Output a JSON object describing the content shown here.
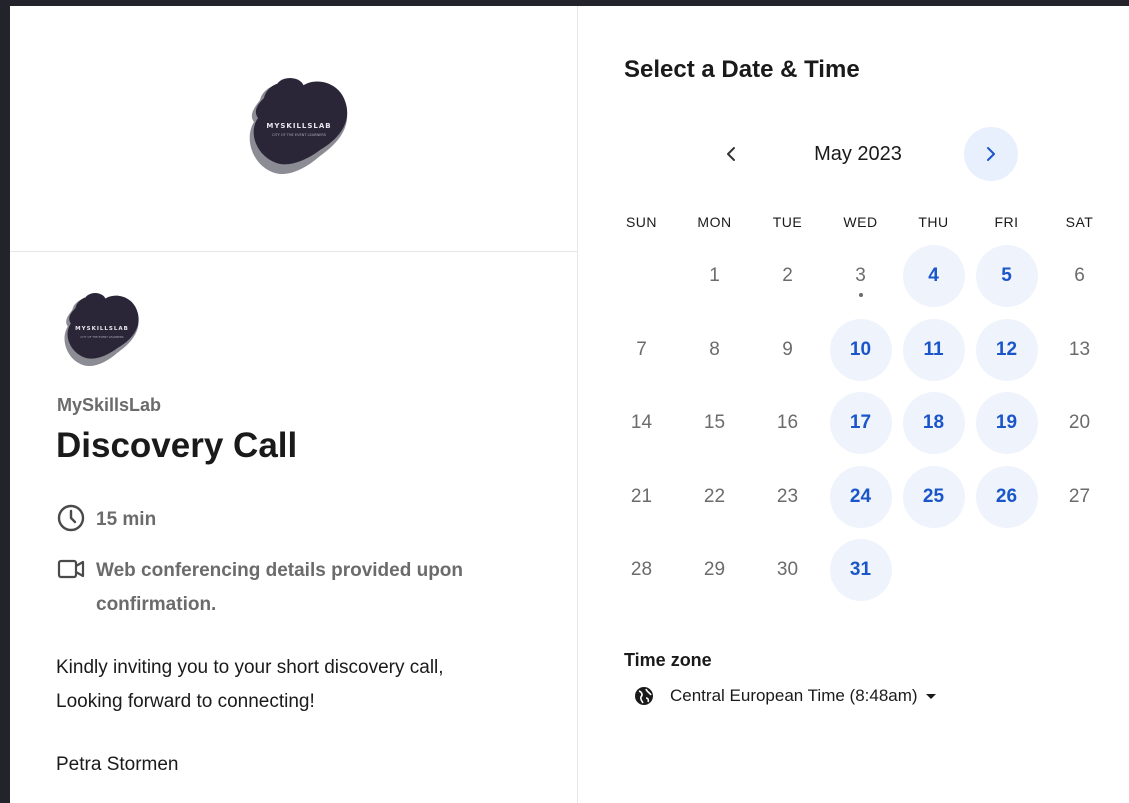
{
  "event": {
    "logo_text": "MYSKILLSLAB",
    "logo_tagline": "CITY OF THE EVENT LEARNERS",
    "organizer": "MySkillsLab",
    "title": "Discovery Call",
    "duration": "15 min",
    "conferencing": "Web conferencing details provided upon confirmation.",
    "description": [
      "Kindly inviting you to your short discovery call,",
      "Looking forward to connecting!"
    ],
    "signature": "Petra Stormen"
  },
  "calendar": {
    "heading": "Select a Date & Time",
    "month_label": "May 2023",
    "weekdays": [
      "SUN",
      "MON",
      "TUE",
      "WED",
      "THU",
      "FRI",
      "SAT"
    ],
    "first_weekday_index": 1,
    "days_in_month": 31,
    "available_days": [
      4,
      5,
      10,
      11,
      12,
      17,
      18,
      19,
      24,
      25,
      26,
      31
    ],
    "today": 3
  },
  "timezone": {
    "label": "Time zone",
    "value": "Central European Time (8:48am)"
  },
  "colors": {
    "available_bg": "#eef3fc",
    "available_text": "#1a56c9",
    "logo_dark": "#2a2638",
    "logo_shadow": "#8c8c94"
  },
  "icons": {
    "duration": "clock-icon",
    "conferencing": "video-camera-icon",
    "prev": "chevron-left-icon",
    "next": "chevron-right-icon",
    "timezone": "globe-icon",
    "dropdown": "caret-down-icon"
  }
}
